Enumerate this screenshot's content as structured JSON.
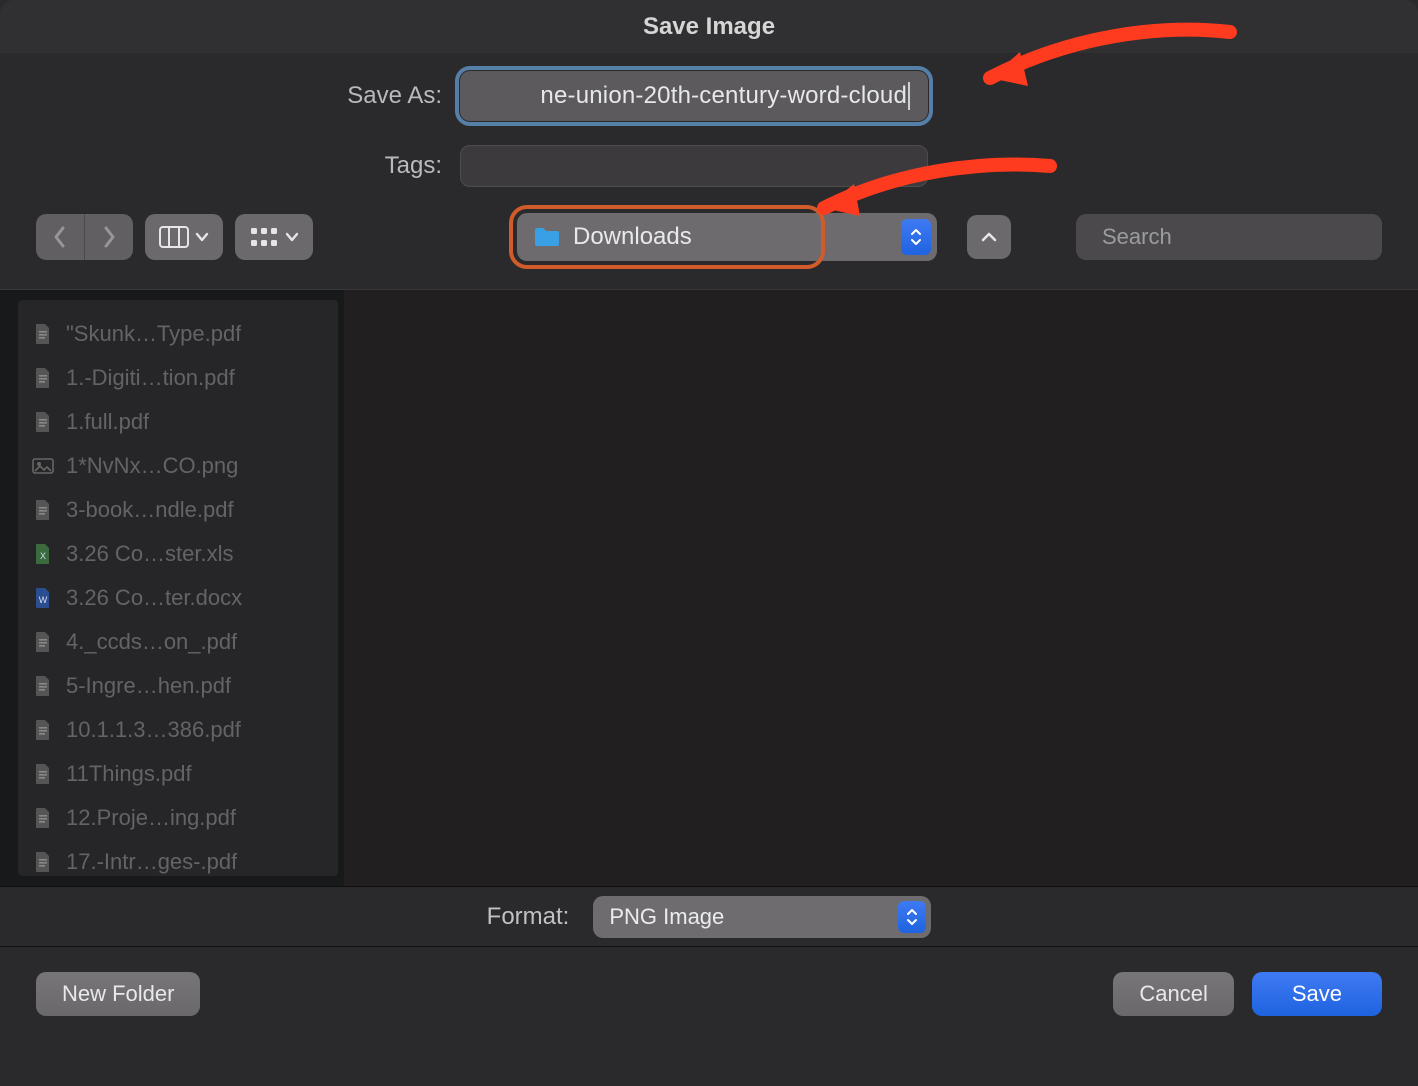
{
  "window": {
    "title": "Save Image"
  },
  "saveAs": {
    "label": "Save As:",
    "value": "ne-union-20th-century-word-cloud"
  },
  "tags": {
    "label": "Tags:",
    "value": ""
  },
  "location": {
    "label": "Downloads"
  },
  "search": {
    "placeholder": "Search"
  },
  "format": {
    "label": "Format:",
    "value": "PNG Image"
  },
  "buttons": {
    "newFolder": "New Folder",
    "cancel": "Cancel",
    "save": "Save"
  },
  "files": [
    {
      "icon": "doc",
      "name": "\"Skunk…Type.pdf"
    },
    {
      "icon": "doc",
      "name": "1.-Digiti…tion.pdf"
    },
    {
      "icon": "doc",
      "name": "1.full.pdf"
    },
    {
      "icon": "image",
      "name": "1*NvNx…CO.png"
    },
    {
      "icon": "doc",
      "name": "3-book…ndle.pdf"
    },
    {
      "icon": "xls",
      "name": "3.26 Co…ster.xls"
    },
    {
      "icon": "docx",
      "name": "3.26 Co…ter.docx"
    },
    {
      "icon": "doc",
      "name": "4._ccds…on_.pdf"
    },
    {
      "icon": "doc",
      "name": "5-Ingre…hen.pdf"
    },
    {
      "icon": "doc",
      "name": "10.1.1.3…386.pdf"
    },
    {
      "icon": "doc",
      "name": "11Things.pdf"
    },
    {
      "icon": "doc",
      "name": "12.Proje…ing.pdf"
    },
    {
      "icon": "doc",
      "name": "17.-Intr…ges-.pdf"
    }
  ]
}
